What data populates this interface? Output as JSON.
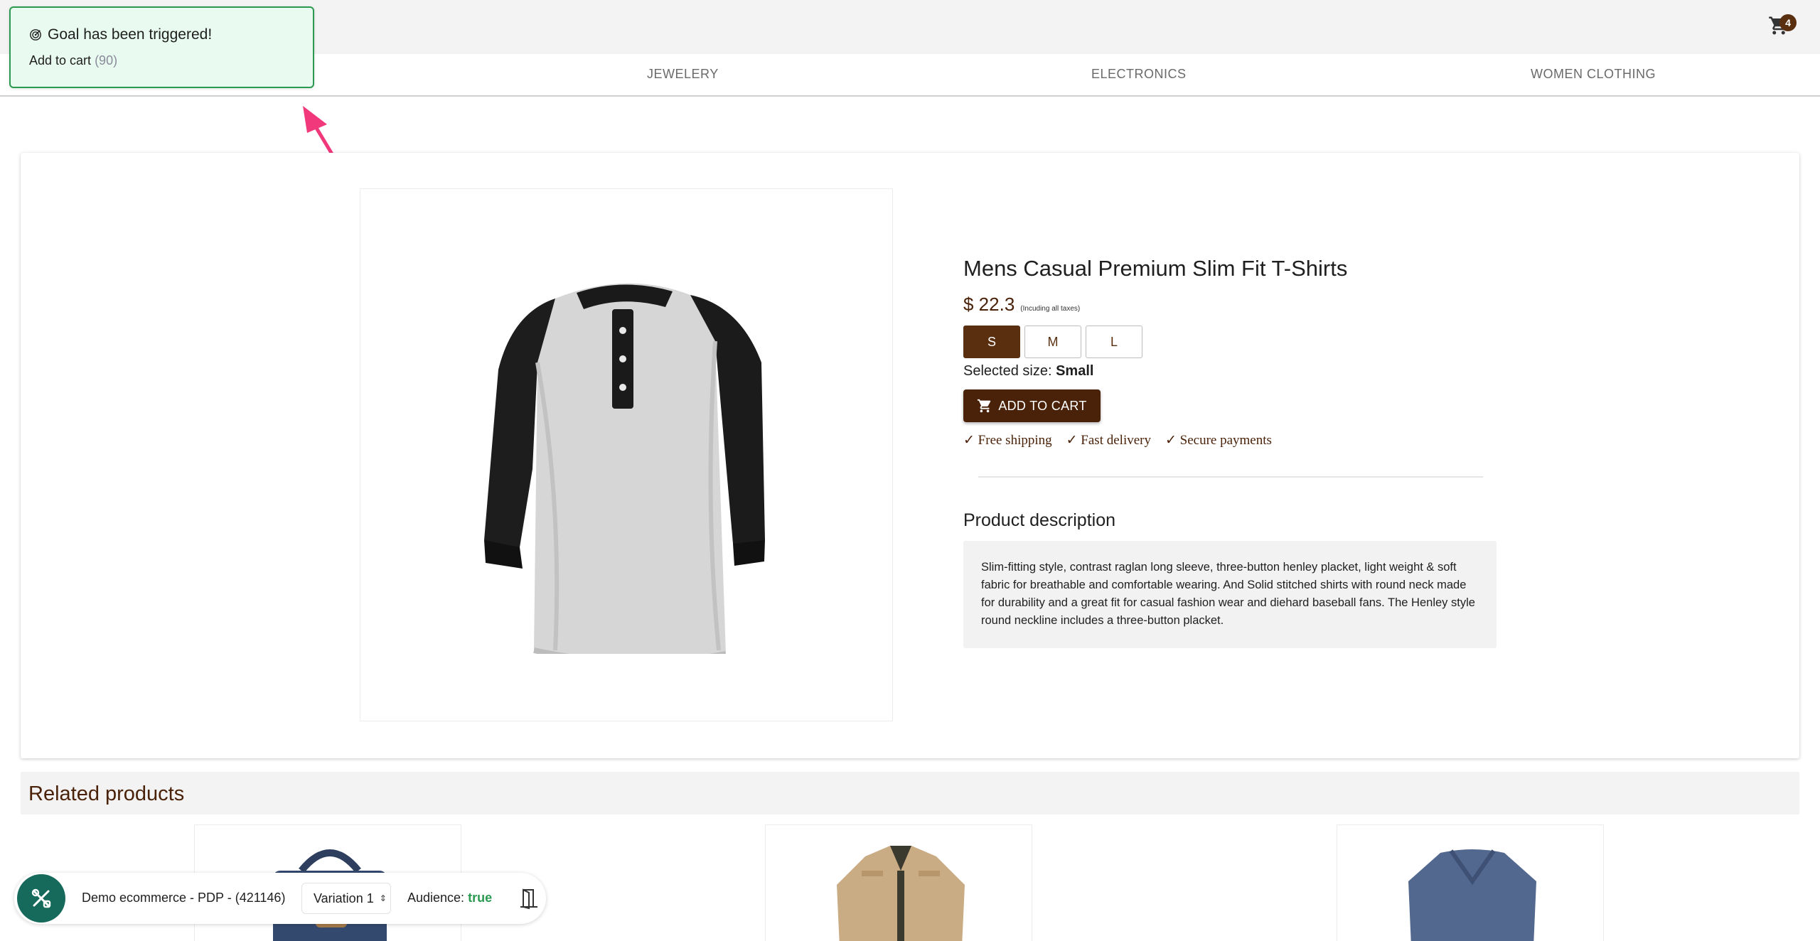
{
  "header": {
    "cart_count": "4"
  },
  "categories": [
    "JEWELERY",
    "ELECTRONICS",
    "WOMEN CLOTHING"
  ],
  "toast": {
    "title": "Goal has been triggered!",
    "goal_name": "Add to cart",
    "goal_count": "(90)"
  },
  "product": {
    "title": "Mens Casual Premium Slim Fit T-Shirts",
    "price": "$ 22.3",
    "tax_note": "(Incuding all taxes)",
    "sizes": [
      "S",
      "M",
      "L"
    ],
    "selected_size_label": "Selected size:",
    "selected_size_value": "Small",
    "add_to_cart_label": "ADD TO CART",
    "perks": [
      "✓ Free shipping",
      "✓ Fast delivery",
      "✓ Secure payments"
    ],
    "description_heading": "Product description",
    "description": "Slim-fitting style, contrast raglan long sleeve, three-button henley placket, light weight & soft fabric for breathable and comfortable wearing. And Solid stitched shirts with round neck made for durability and a great fit for casual fashion wear and diehard baseball fans. The Henley style round neckline includes a three-button placket."
  },
  "related": {
    "heading": "Related products"
  },
  "widget": {
    "experiment_name": "Demo ecommerce - PDP - (421146)",
    "variation": "Variation 1",
    "audience_label": "Audience:",
    "audience_value": "true"
  },
  "colors": {
    "brand_brown": "#4a2209",
    "toast_green": "#2b9a51",
    "widget_teal": "#166a5b",
    "arrow_pink": "#f0387a"
  }
}
